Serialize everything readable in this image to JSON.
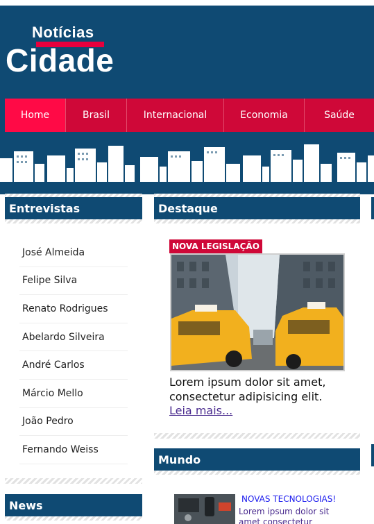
{
  "logo": {
    "top_text": "Notícias",
    "main_text": "Cidade"
  },
  "nav": {
    "items": [
      {
        "label": "Home",
        "active": true
      },
      {
        "label": "Brasil",
        "active": false
      },
      {
        "label": "Internacional",
        "active": false
      },
      {
        "label": "Economia",
        "active": false
      },
      {
        "label": "Saúde",
        "active": false
      }
    ]
  },
  "interviews": {
    "title": "Entrevistas",
    "items": [
      "José Almeida",
      "Felipe Silva",
      "Renato Rodrigues",
      "Abelardo Silveira",
      "André Carlos",
      "Márcio Mello",
      "João Pedro",
      "Fernando Weiss"
    ]
  },
  "news": {
    "title": "News"
  },
  "featured": {
    "title": "Destaque",
    "tag": "NOVA LEGISLAÇÃO",
    "lead": "Lorem ipsum dolor sit amet, consectetur adipisicing elit.",
    "more": "Leia mais..."
  },
  "world": {
    "title": "Mundo",
    "tag": "NOVAS TECNOLOGIAS!",
    "text": "Lorem ipsum dolor sit amet consectetur"
  },
  "colors": {
    "brand_blue": "#0f4a73",
    "nav_red": "#cf0838",
    "nav_active": "#ff0a46",
    "link": "#4b2c8f"
  }
}
